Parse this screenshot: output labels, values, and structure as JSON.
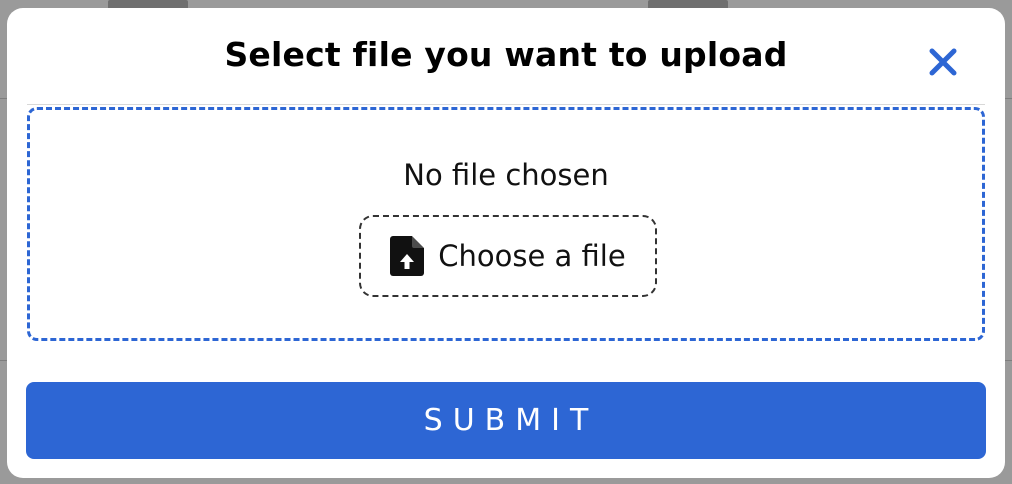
{
  "modal": {
    "title": "Select file you want to upload",
    "close_icon": "close-icon",
    "dropzone": {
      "status_text": "No file chosen",
      "choose_button_label": "Choose a file",
      "choose_button_icon": "file-upload-icon"
    },
    "submit_label": "SUBMIT"
  },
  "colors": {
    "accent": "#2d66d4",
    "text": "#111111",
    "modal_background": "#ffffff"
  }
}
